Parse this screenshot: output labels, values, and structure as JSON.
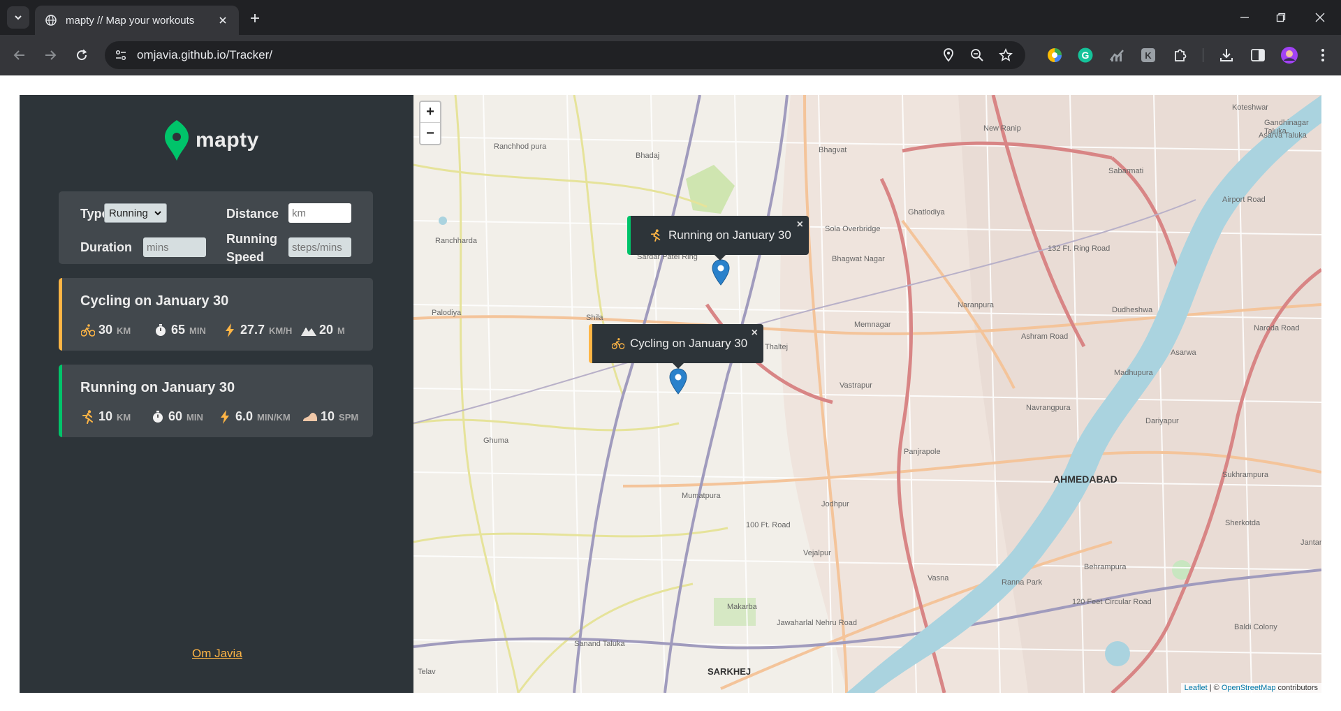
{
  "browser": {
    "tab_title": "mapty // Map your workouts",
    "url": "omjavia.github.io/Tracker/"
  },
  "app": {
    "logo_text": "mapty",
    "form": {
      "type_label": "Type",
      "type_value": "Running",
      "distance_label": "Distance",
      "distance_placeholder": "km",
      "duration_label": "Duration",
      "duration_placeholder": "mins",
      "cadence_label_line1": "Running",
      "cadence_label_line2": "Speed",
      "cadence_placeholder": "steps/mins"
    },
    "workouts": [
      {
        "title": "Cycling on January 30",
        "type": "cycling",
        "stats": [
          {
            "icon": "cycling-icon",
            "value": "30",
            "unit": "km"
          },
          {
            "icon": "stopwatch-icon",
            "value": "65",
            "unit": "min"
          },
          {
            "icon": "lightning-icon",
            "value": "27.7",
            "unit": "km/h"
          },
          {
            "icon": "mountain-icon",
            "value": "20",
            "unit": "m"
          }
        ]
      },
      {
        "title": "Running on January 30",
        "type": "running",
        "stats": [
          {
            "icon": "running-icon",
            "value": "10",
            "unit": "km"
          },
          {
            "icon": "stopwatch-icon",
            "value": "60",
            "unit": "min"
          },
          {
            "icon": "lightning-icon",
            "value": "6.0",
            "unit": "min/km"
          },
          {
            "icon": "footprint-icon",
            "value": "10",
            "unit": "spm"
          }
        ]
      }
    ],
    "author": "Om Javia"
  },
  "map": {
    "zoom_in": "+",
    "zoom_out": "−",
    "popups": [
      {
        "text": "Running on January 30",
        "close": "×"
      },
      {
        "text": "Cycling on January 30",
        "close": "×"
      }
    ],
    "places": [
      "Ranchhod pura",
      "Bhadaj",
      "Bhagvat",
      "New Ranip",
      "Koteshwar",
      "Gandhinagar Taluka",
      "Asarva Taluka",
      "Sabarmati",
      "Ghatlodiya",
      "Ranchharda",
      "132 Ft. Ring Road",
      "Airport Road",
      "Sola Overbridge",
      "Bhagwat Nagar",
      "Naranpura",
      "Dudheshwa",
      "Palodiya",
      "Memnagar",
      "Asarwa",
      "Naroda Road",
      "Madhupura",
      "Shila",
      "Thaltej",
      "Vastrapur",
      "Navrangpura",
      "Dariyapur",
      "Ashram Road",
      "Ghuma",
      "Panjrapole",
      "AHMEDABAD",
      "Sukhrampura",
      "Mumatpura",
      "Jodhpur",
      "100 Ft. Road",
      "Sherkotda",
      "Jantar",
      "Vejalpur",
      "Vasna",
      "Behrampura",
      "Ranna Park",
      "120 Feet Circular Road",
      "Makarba",
      "Jawaharlal Nehru Road",
      "Baldi Colony",
      "Telav",
      "SARKHEJ",
      "Sanand Taluka",
      "Sardar Patel Ring"
    ],
    "attribution_leaflet": "Leaflet",
    "attribution_sep": " | © ",
    "attribution_osm": "OpenStreetMap",
    "attribution_tail": " contributors"
  },
  "colors": {
    "sidebar_bg": "#2d3439",
    "card_bg": "#42484d",
    "running_accent": "#00c46a",
    "cycling_accent": "#ffb545",
    "marker_blue": "#2a81cb"
  }
}
